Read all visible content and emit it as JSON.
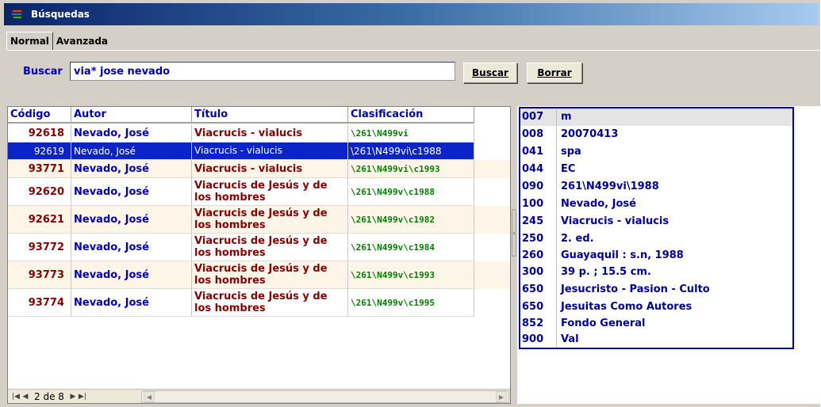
{
  "window": {
    "title": "Búsquedas"
  },
  "tabs": [
    {
      "label": "Normal"
    },
    {
      "label": "Avanzada"
    }
  ],
  "search": {
    "label": "Buscar",
    "value": "via* jose nevado",
    "search_button": "Buscar",
    "clear_button": "Borrar"
  },
  "grid": {
    "headers": {
      "codigo": "Código",
      "autor": "Autor",
      "titulo": "Título",
      "clasificacion": "Clasificación"
    },
    "rows": [
      {
        "codigo": "92618",
        "autor": "Nevado, José",
        "titulo": "Viacrucis - vialucis",
        "clasificacion": "\\261\\N499vi"
      },
      {
        "codigo": "92619",
        "autor": "Nevado, José",
        "titulo": "Viacrucis - vialucis",
        "clasificacion": "\\261\\N499vi\\c1988",
        "selected": true
      },
      {
        "codigo": "93771",
        "autor": "Nevado, José",
        "titulo": "Viacrucis - vialucis",
        "clasificacion": "\\261\\N499vi\\c1993"
      },
      {
        "codigo": "92620",
        "autor": "Nevado, José",
        "titulo": "Viacrucis de Jesús y de los hombres",
        "clasificacion": "\\261\\N499v\\c1988"
      },
      {
        "codigo": "92621",
        "autor": "Nevado, José",
        "titulo": "Viacrucis de Jesús y de los hombres",
        "clasificacion": "\\261\\N499v\\c1982"
      },
      {
        "codigo": "93772",
        "autor": "Nevado, José",
        "titulo": "Viacrucis de Jesús y de los hombres",
        "clasificacion": "\\261\\N499v\\c1984"
      },
      {
        "codigo": "93773",
        "autor": "Nevado, José",
        "titulo": "Viacrucis de Jesús y de los hombres",
        "clasificacion": "\\261\\N499v\\c1993"
      },
      {
        "codigo": "93774",
        "autor": "Nevado, José",
        "titulo": "Viacrucis de Jesús y de los hombres",
        "clasificacion": "\\261\\N499v\\c1995"
      }
    ]
  },
  "pager": {
    "text": "2 de 8"
  },
  "marc": [
    {
      "tag": "007",
      "value": "m"
    },
    {
      "tag": "008",
      "value": "20070413"
    },
    {
      "tag": "041",
      "value": "spa"
    },
    {
      "tag": "044",
      "value": "EC"
    },
    {
      "tag": "090",
      "value": "261\\N499vi\\1988"
    },
    {
      "tag": "100",
      "value": "Nevado, José"
    },
    {
      "tag": "245",
      "value": "Viacrucis - vialucis"
    },
    {
      "tag": "250",
      "value": "2. ed."
    },
    {
      "tag": "260",
      "value": "Guayaquil : s.n, 1988"
    },
    {
      "tag": "300",
      "value": "39 p. ; 15.5 cm."
    },
    {
      "tag": "650",
      "value": "Jesucristo - Pasion - Culto"
    },
    {
      "tag": "650",
      "value": "Jesuitas Como Autores"
    },
    {
      "tag": "852",
      "value": "Fondo General"
    },
    {
      "tag": "900",
      "value": "Val"
    }
  ]
}
